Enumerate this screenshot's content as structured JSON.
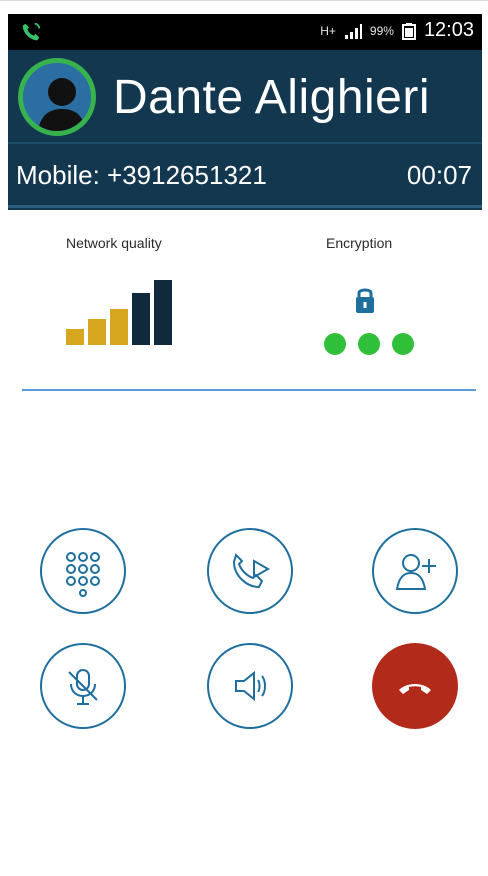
{
  "status_bar": {
    "network_type": "H+",
    "battery_percent": "99%",
    "time": "12:03",
    "call_icon": "phone-call-icon"
  },
  "call": {
    "contact_name": "Dante Alighieri",
    "number_label": "Mobile: +3912651321",
    "timer": "00:07",
    "avatar_icon": "person-avatar-icon"
  },
  "metrics": {
    "network_quality_label": "Network quality",
    "encryption_label": "Encryption",
    "network_bars_levels": [
      0.22,
      0.36,
      0.5,
      0.72,
      0.9
    ],
    "network_bar_colors": [
      "#d6a61e",
      "#d6a61e",
      "#d6a61e",
      "#102a3d",
      "#102a3d"
    ],
    "encryption_dots": 3,
    "encryption_dot_color": "#2fbf39",
    "lock_icon": "lock-icon"
  },
  "controls": {
    "row1": [
      {
        "name": "keypad-button",
        "icon": "keypad-icon"
      },
      {
        "name": "transfer-call-button",
        "icon": "phone-play-icon"
      },
      {
        "name": "add-participant-button",
        "icon": "add-user-icon"
      }
    ],
    "row2": [
      {
        "name": "mute-button",
        "icon": "mic-off-icon"
      },
      {
        "name": "speaker-button",
        "icon": "speaker-icon"
      },
      {
        "name": "end-call-button",
        "icon": "hangup-icon"
      }
    ]
  },
  "colors": {
    "header_bg": "#12374f",
    "accent_blue": "#1f6f9e",
    "danger": "#b22b1a",
    "success": "#2fbf39",
    "separator": "#5b9bd5"
  }
}
